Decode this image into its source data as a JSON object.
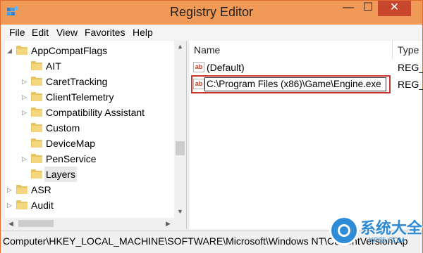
{
  "window": {
    "title": "Registry Editor",
    "minimize": "—",
    "maximize": "☐",
    "close": "✕"
  },
  "menu": [
    "File",
    "Edit",
    "View",
    "Favorites",
    "Help"
  ],
  "tree": {
    "items": [
      {
        "label": "AppCompatFlags",
        "expander": "◢"
      },
      {
        "label": "AIT",
        "expander": ""
      },
      {
        "label": "CaretTracking",
        "expander": "▷"
      },
      {
        "label": "ClientTelemetry",
        "expander": "▷"
      },
      {
        "label": "Compatibility Assistant",
        "expander": "▷"
      },
      {
        "label": "Custom",
        "expander": ""
      },
      {
        "label": "DeviceMap",
        "expander": ""
      },
      {
        "label": "PenService",
        "expander": "▷"
      },
      {
        "label": "Layers",
        "expander": ""
      },
      {
        "label": "ASR",
        "expander": "▷"
      },
      {
        "label": "Audit",
        "expander": "▷"
      }
    ]
  },
  "values_list": {
    "columns": {
      "name": "Name",
      "type": "Type"
    },
    "rows": [
      {
        "name": "(Default)",
        "type": "REG_",
        "icon": "ab"
      },
      {
        "name": "C:\\Program Files (x86)\\Game\\Engine.exe",
        "type": "REG_",
        "icon": "ab"
      }
    ]
  },
  "status": {
    "path": "Computer\\HKEY_LOCAL_MACHINE\\SOFTWARE\\Microsoft\\Windows NT\\CurrentVersion\\Ap"
  },
  "watermark": {
    "brand": "系统大全",
    "site": "XP85.COM"
  },
  "colors": {
    "titlebar": "#f19a58",
    "close": "#c7472c",
    "highlight": "#c8372d",
    "folder": "#e8c460"
  }
}
